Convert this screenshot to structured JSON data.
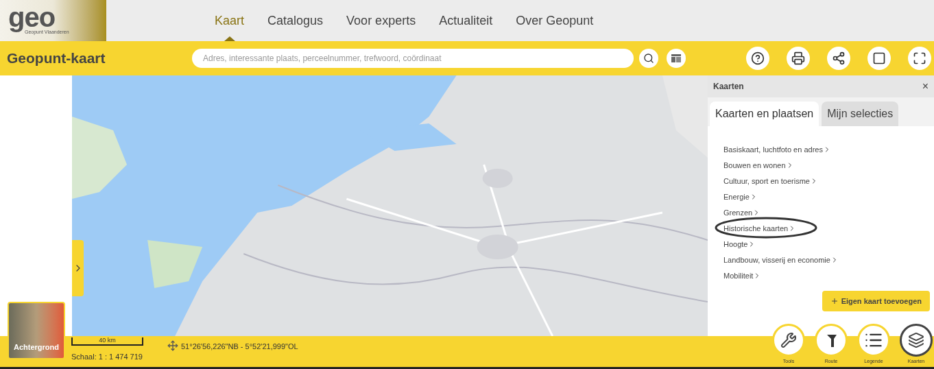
{
  "logo": {
    "text": "geo",
    "subtitle": "Geopunt Vlaanderen"
  },
  "nav": [
    {
      "label": "Kaart",
      "selected": true
    },
    {
      "label": "Catalogus",
      "selected": false
    },
    {
      "label": "Voor experts",
      "selected": false
    },
    {
      "label": "Actualiteit",
      "selected": false
    },
    {
      "label": "Over Geopunt",
      "selected": false
    }
  ],
  "toolbar": {
    "title": "Geopunt-kaart",
    "search": {
      "placeholder": "Adres, interessante plaats, perceelnummer, trefwoord, coördinaat"
    }
  },
  "panel": {
    "title": "Kaarten",
    "close": "×",
    "tabs": [
      {
        "label": "Kaarten en plaatsen",
        "selected": true
      },
      {
        "label": "Mijn selecties",
        "selected": false
      }
    ],
    "items": [
      {
        "label": "Basiskaart, luchtfoto en adres",
        "circled": false
      },
      {
        "label": "Bouwen en wonen",
        "circled": false
      },
      {
        "label": "Cultuur, sport en toerisme",
        "circled": false
      },
      {
        "label": "Energie",
        "circled": false
      },
      {
        "label": "Grenzen",
        "circled": false
      },
      {
        "label": "Historische kaarten",
        "circled": true
      },
      {
        "label": "Hoogte",
        "circled": false
      },
      {
        "label": "Landbouw, visserij en economie",
        "circled": false
      },
      {
        "label": "Mobiliteit",
        "circled": false
      }
    ],
    "add_button": "Eigen kaart toevoegen"
  },
  "background_toggle": {
    "label": "Achtergrond"
  },
  "status": {
    "scale_bar": "40 km",
    "scale": "Schaal: 1 : 1 474 719",
    "coordinates": "51°26'56,226\"NB - 5°52'21,999\"OL"
  },
  "bottom_tools": [
    {
      "label": "Tools",
      "kind": "wrench",
      "selected": false
    },
    {
      "label": "Route",
      "kind": "route",
      "selected": false
    },
    {
      "label": "Legende",
      "kind": "list",
      "selected": false
    },
    {
      "label": "Kaarten",
      "kind": "layers",
      "selected": true
    }
  ]
}
